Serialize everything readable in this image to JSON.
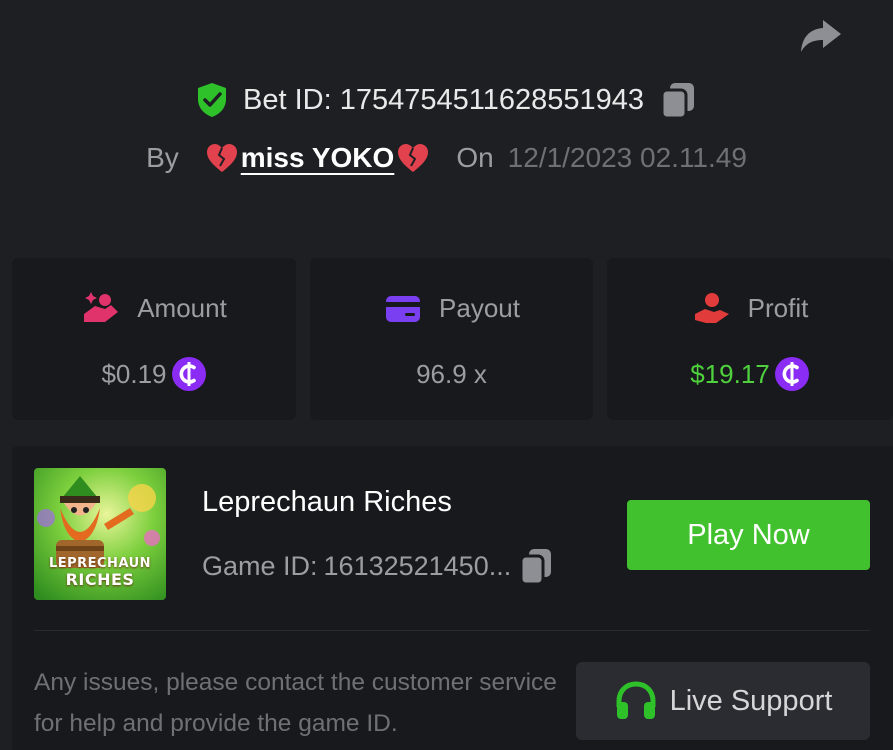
{
  "header": {
    "bet_label": "Bet ID:",
    "bet_id": "17547545116285519​43",
    "by_label": "By",
    "username": "miss YOKO",
    "on_label": "On",
    "date": "12/1/2023 02.11.49"
  },
  "stats": [
    {
      "label": "Amount",
      "value": "$0.19",
      "icon": "money-hand-icon",
      "has_coin": true
    },
    {
      "label": "Payout",
      "value": "96.9 x",
      "icon": "card-icon",
      "has_coin": false
    },
    {
      "label": "Profit",
      "value": "$19.17",
      "icon": "profit-hand-icon",
      "has_coin": true
    }
  ],
  "game": {
    "name": "Leprechaun Riches",
    "id_label": "Game ID:",
    "id_value": "16132521450...",
    "thumb_title_line1": "LEPRECHAUN",
    "thumb_title_line2": "RICHES",
    "play_label": "Play Now"
  },
  "support": {
    "notice": "Any issues, please contact the customer service for help and provide the game ID.",
    "button_label": "Live Support"
  },
  "colors": {
    "background": "#1e1f23",
    "card": "#18191c",
    "accent_green": "#42c12e",
    "profit_green": "#4fd13e",
    "coin_purple": "#8b2cf5"
  }
}
